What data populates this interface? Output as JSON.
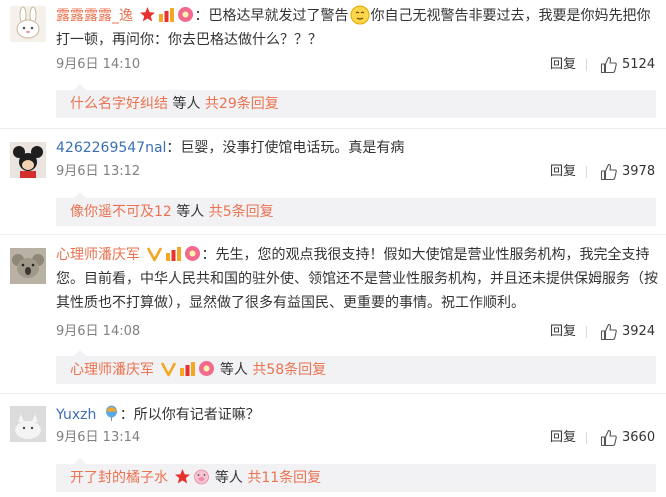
{
  "colors": {
    "username": "#eb7350",
    "text": "#333333",
    "meta": "#808080",
    "reply_bar_bg": "#f2f2f5"
  },
  "comments": [
    {
      "username": "露露露露_逸",
      "username_suffix": "：",
      "text_line1": "巴格达早就发过了警告",
      "text_line1b": "你自己无视警告非要过去，我要是你妈先把你",
      "text_line2": "打一顿，再问你：你去巴格达做什么？？？",
      "date": "9月6日 14:10",
      "reply_label": "回复",
      "likes": "5124",
      "reply_summary": {
        "name": "什么名字好纠结",
        "suffix": " 等人 ",
        "count_text": "共29条回复"
      }
    },
    {
      "username": "4262269547nal",
      "username_suffix": "：",
      "text_line1": "巨婴，没事打使馆电话玩。真是有病",
      "date": "9月6日 13:12",
      "reply_label": "回复",
      "likes": "3978",
      "reply_summary": {
        "name": "像你遥不可及12",
        "suffix": " 等人 ",
        "count_text": "共5条回复"
      }
    },
    {
      "username": "心理师潘庆军",
      "username_suffix": "：",
      "text_line1": "先生，您的观点我很支持！假如大使馆是营业性服务机构，我完全支持",
      "text_line2": "您。目前看，中华人民共和国的驻外使、领馆还不是营业性服务机构，并且还未提供保姆服务（按",
      "text_line3": "其性质也不打算做），显然做了很多有益国民、更重要的事情。祝工作顺利。",
      "date": "9月6日 14:08",
      "reply_label": "回复",
      "likes": "3924",
      "reply_summary": {
        "name": "心理师潘庆军",
        "suffix": " 等人 ",
        "count_text": "共58条回复"
      }
    },
    {
      "username": "Yuxzh",
      "username_suffix": "：",
      "text_line1": "所以你有记者证嘛？",
      "date": "9月6日 13:14",
      "reply_label": "回复",
      "likes": "3660",
      "reply_summary": {
        "name": "开了封的橘子水",
        "suffix": " 等人 ",
        "count_text": "共11条回复"
      }
    }
  ]
}
